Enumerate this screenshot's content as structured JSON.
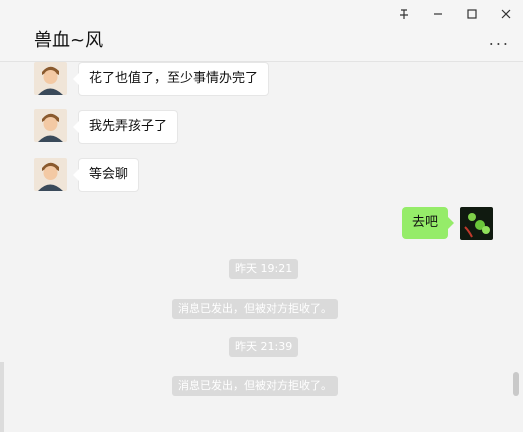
{
  "header": {
    "title": "兽血~风",
    "pin_icon": "pin-icon",
    "minimize_icon": "minimize-icon",
    "maximize_icon": "maximize-icon",
    "close_icon": "close-icon",
    "more_icon": "more-icon",
    "more_text": "..."
  },
  "messages": [
    {
      "side": "in",
      "text": "花了也值了，至少事情办完了"
    },
    {
      "side": "in",
      "text": "我先弄孩子了"
    },
    {
      "side": "in",
      "text": "等会聊"
    },
    {
      "side": "out",
      "text": "去吧"
    }
  ],
  "system": [
    {
      "text": "昨天 19:21"
    },
    {
      "text": "消息已发出，但被对方拒收了。"
    },
    {
      "text": "昨天 21:39"
    },
    {
      "text": "消息已发出，但被对方拒收了。"
    }
  ],
  "colors": {
    "out_bubble": "#95ec69",
    "in_bubble": "#ffffff",
    "background": "#f3f3f3"
  }
}
